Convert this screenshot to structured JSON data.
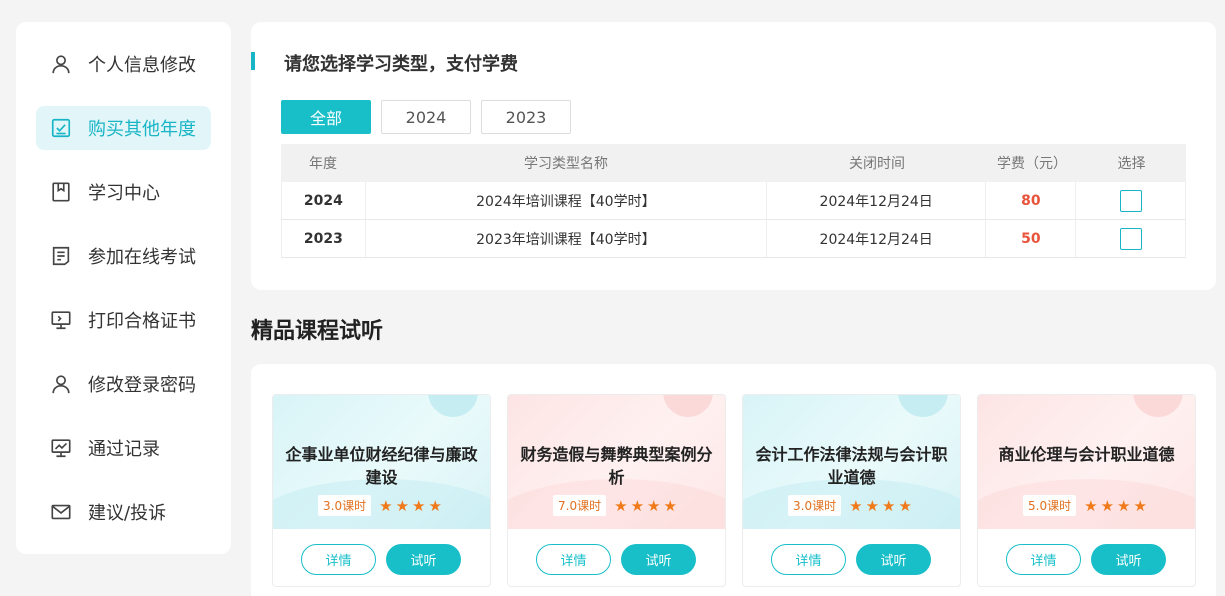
{
  "sidebar": {
    "items": [
      {
        "label": "个人信息修改",
        "icon": "user-icon",
        "active": false
      },
      {
        "label": "购买其他年度",
        "icon": "checkbox-icon",
        "active": true
      },
      {
        "label": "学习中心",
        "icon": "bookmark-icon",
        "active": false
      },
      {
        "label": "参加在线考试",
        "icon": "exam-icon",
        "active": false
      },
      {
        "label": "打印合格证书",
        "icon": "monitor-icon",
        "active": false
      },
      {
        "label": "修改登录密码",
        "icon": "user-lock-icon",
        "active": false
      },
      {
        "label": "通过记录",
        "icon": "chart-icon",
        "active": false
      },
      {
        "label": "建议/投诉",
        "icon": "mail-icon",
        "active": false
      }
    ]
  },
  "payment": {
    "title": "请您选择学习类型，支付学费",
    "filters": [
      "全部",
      "2024",
      "2023"
    ],
    "active_filter": "全部",
    "columns": [
      "年度",
      "学习类型名称",
      "关闭时间",
      "学费（元）",
      "选择"
    ],
    "rows": [
      {
        "year": "2024",
        "name": "2024年培训课程【40学时】",
        "close": "2024年12月24日",
        "fee": "80"
      },
      {
        "year": "2023",
        "name": "2023年培训课程【40学时】",
        "close": "2024年12月24日",
        "fee": "50"
      }
    ]
  },
  "courses": {
    "section_title": "精品课程试听",
    "detail_label": "详情",
    "trial_label": "试听",
    "items": [
      {
        "title": "企事业单位财经纪律与廉政建设",
        "hours": "3.0课时",
        "stars": "★★★★",
        "theme": "teal"
      },
      {
        "title": "财务造假与舞弊典型案例分析",
        "hours": "7.0课时",
        "stars": "★★★★",
        "theme": "pink"
      },
      {
        "title": "会计工作法律法规与会计职业道德",
        "hours": "3.0课时",
        "stars": "★★★★",
        "theme": "teal"
      },
      {
        "title": "商业伦理与会计职业道德",
        "hours": "5.0课时",
        "stars": "★★★★",
        "theme": "pink"
      }
    ]
  },
  "colors": {
    "accent": "#18b5c6",
    "fee": "#e8543b",
    "star": "#f07a1a"
  }
}
